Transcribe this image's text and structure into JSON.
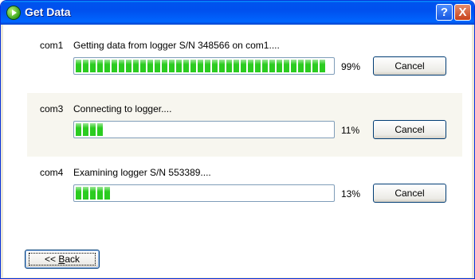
{
  "window": {
    "title": "Get Data",
    "icon": "green-play-icon",
    "help_glyph": "?",
    "close_glyph": "X",
    "colors": {
      "titlebar": "#0054e3",
      "frame": "#ece9d8",
      "progress": "#2bcc20"
    }
  },
  "jobs": [
    {
      "port": "com1",
      "message": "Getting data from logger S/N 348566 on com1....",
      "progress": 99,
      "percent_label": "99%",
      "cancel_label": "Cancel"
    },
    {
      "port": "com3",
      "message": "Connecting to logger....",
      "progress": 11,
      "percent_label": "11%",
      "cancel_label": "Cancel"
    },
    {
      "port": "com4",
      "message": "Examining logger S/N 553389....",
      "progress": 13,
      "percent_label": "13%",
      "cancel_label": "Cancel"
    }
  ],
  "footer": {
    "back_prefix": "<< ",
    "back_mnemonic": "B",
    "back_rest": "ack"
  }
}
